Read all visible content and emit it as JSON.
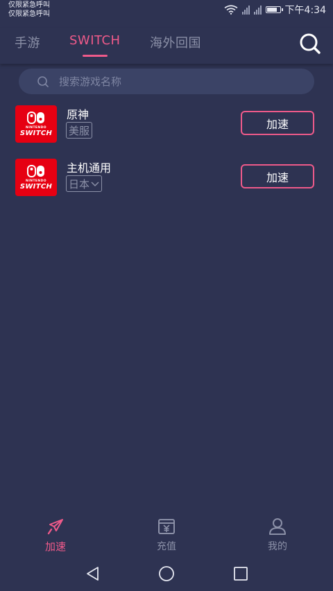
{
  "status_bar": {
    "carrier_line1": "仅限紧急呼叫",
    "carrier_line2": "仅限紧急呼叫",
    "time": "下午4:34"
  },
  "top_tabs": [
    {
      "label": "手游",
      "active": false
    },
    {
      "label": "SWITCH",
      "active": true
    },
    {
      "label": "海外回国",
      "active": false
    }
  ],
  "search": {
    "placeholder": "搜索游戏名称"
  },
  "games": [
    {
      "name": "原神",
      "region": "美服",
      "has_dropdown": false,
      "icon": "nintendo-switch-logo",
      "logo_small": "NINTENDO",
      "logo_big": "SWITCH",
      "action": "加速"
    },
    {
      "name": "主机通用",
      "region": "日本",
      "has_dropdown": true,
      "icon": "nintendo-switch-logo",
      "logo_small": "NINTENDO",
      "logo_big": "SWITCH",
      "action": "加速"
    }
  ],
  "bottom_nav": [
    {
      "label": "加速",
      "icon": "rocket-icon",
      "active": true
    },
    {
      "label": "充值",
      "icon": "wallet-yen-icon",
      "active": false
    },
    {
      "label": "我的",
      "icon": "user-icon",
      "active": false
    }
  ],
  "colors": {
    "background": "#2e3352",
    "accent": "#ef5a8a",
    "muted": "#8c91a8",
    "search_bg": "#3b4366",
    "switch_red": "#e60012"
  }
}
